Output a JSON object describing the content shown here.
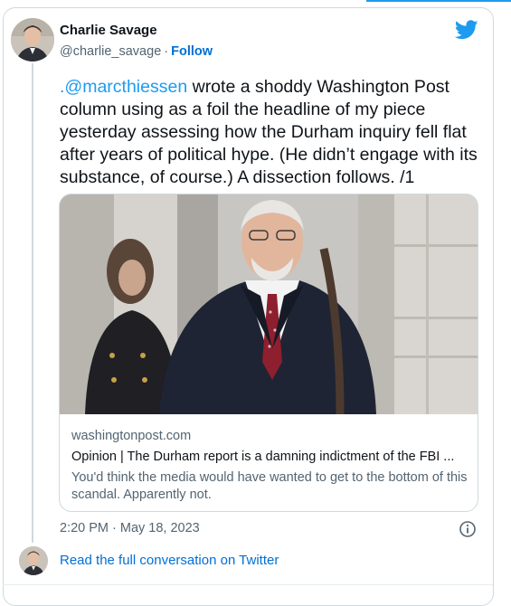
{
  "author": {
    "name": "Charlie Savage",
    "handle": "@charlie_savage",
    "separator": "·",
    "follow_label": "Follow"
  },
  "tweet": {
    "mention": ".@marcthiessen",
    "text": " wrote a shoddy Washington Post column using as a foil the headline of my piece yesterday assessing how the Durham inquiry fell flat after years of political hype. (He didn’t engage with its substance, of course.) A dissection follows. /1",
    "timestamp": "2:20 PM · May 18, 2023"
  },
  "link_card": {
    "domain": "washingtonpost.com",
    "title": "Opinion | The Durham report is a damning indictment of the FBI ...",
    "description": "You'd think the media would have wanted to get to the bottom of this scandal. Apparently not."
  },
  "footer": {
    "read_more_label": "Read the full conversation on Twitter"
  },
  "icons": {
    "brand": "twitter-bird-icon",
    "info": "info-icon"
  },
  "colors": {
    "brand_blue": "#1d9bf0",
    "link_blue": "#006fd6",
    "secondary_text": "#536471",
    "border": "#cfd9de"
  }
}
